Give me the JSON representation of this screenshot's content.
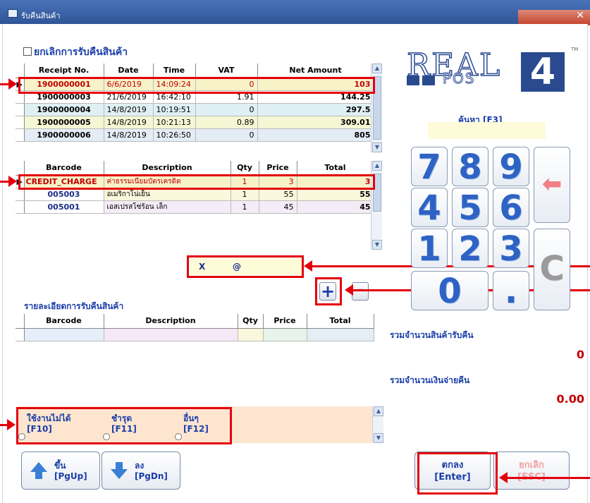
{
  "window": {
    "title": "รับคืนสินค้า",
    "close_glyph": "✕"
  },
  "cancel_return_label": "ยกเลิกการรับคืนสินค้า",
  "receipts": {
    "columns": [
      "Receipt No.",
      "Date",
      "Time",
      "VAT",
      "Net Amount"
    ],
    "rows": [
      [
        "1900000001",
        "6/6/2019",
        "14:09:24",
        "0",
        "103"
      ],
      [
        "1900000003",
        "21/6/2019",
        "16:42:10",
        "1.91",
        "144.25"
      ],
      [
        "1900000004",
        "14/8/2019",
        "10:19:51",
        "0",
        "297.5"
      ],
      [
        "1900000005",
        "14/8/2019",
        "10:21:13",
        "0.89",
        "309.01"
      ],
      [
        "1900000006",
        "14/8/2019",
        "10:26:50",
        "0",
        "805"
      ]
    ]
  },
  "items": {
    "columns": [
      "Barcode",
      "Description",
      "Qty",
      "Price",
      "Total"
    ],
    "rows": [
      [
        "CREDIT_CHARGE",
        "ค่าธรรมเนียมบัตรเครดิต",
        "1",
        "3",
        "3"
      ],
      [
        "005003",
        "อเมริกาโน่เย็น",
        "1",
        "55",
        "55"
      ],
      [
        "005001",
        "เอสเปรสโซ่ร้อน เล็ก",
        "1",
        "45",
        "45"
      ]
    ]
  },
  "qty_field": {
    "x_label": "X",
    "at_label": "@"
  },
  "plus_label": "+",
  "minus_label": "-",
  "return_details": {
    "title": "รายละเอียดการรับคืนสินค้า",
    "columns": [
      "Barcode",
      "Description",
      "Qty",
      "Price",
      "Total"
    ]
  },
  "reasons": [
    {
      "label": "ใช้งานไม่ได้",
      "key": "[F10]"
    },
    {
      "label": "ชำรุด",
      "key": "[F11]"
    },
    {
      "label": "อื่นๆ",
      "key": "[F12]"
    }
  ],
  "nav": {
    "up": {
      "label": "ขึ้น",
      "key": "[PgUp]"
    },
    "down": {
      "label": "ลง",
      "key": "[PgDn]"
    }
  },
  "logo": {
    "word": "REAL",
    "sub": "POS",
    "number": "4",
    "tm": "TM"
  },
  "search": {
    "label": "ค้นหา [F3]",
    "value": ""
  },
  "keypad": {
    "keys": [
      "7",
      "8",
      "9",
      "4",
      "5",
      "6",
      "1",
      "2",
      "3",
      "0",
      "."
    ],
    "backspace_glyph": "⬅",
    "clear": "C"
  },
  "summary": {
    "qty_label": "รวมจำนวนสินค้ารับคืน",
    "qty_value": "0",
    "amount_label": "รวมจำนวนเงินจ่ายคืน",
    "amount_value": "0.00"
  },
  "actions": {
    "ok": {
      "label": "ตกลง",
      "key": "[Enter]"
    },
    "cancel": {
      "label": "ยกเลิก",
      "key": "[ESC]"
    }
  },
  "colors": {
    "highlight": "#e3000b",
    "accent_text": "#1a3ea8",
    "amount_red": "#c00000",
    "field_yellow": "#fdfbd8"
  }
}
